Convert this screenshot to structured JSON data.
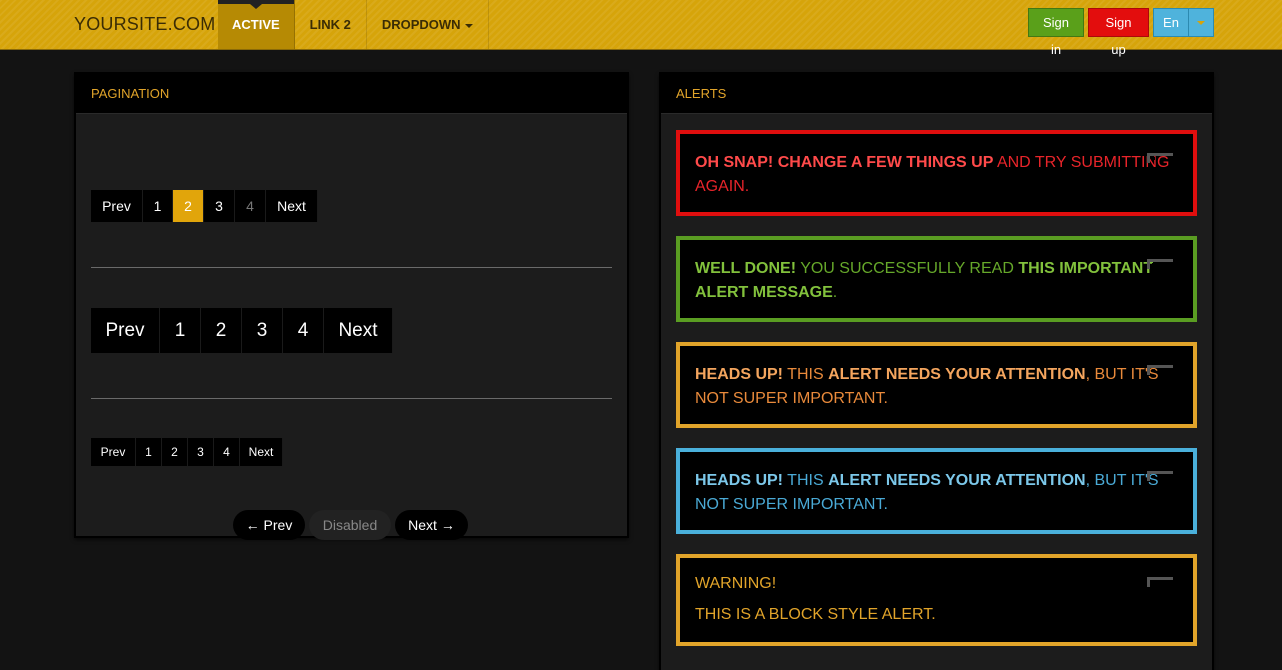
{
  "navbar": {
    "brand": "YOURSITE.COM",
    "items": [
      {
        "label": "ACTIVE"
      },
      {
        "label": "LINK 2"
      },
      {
        "label": "DROPDOWN"
      }
    ],
    "signin": "Sign in",
    "signup": "Sign up",
    "language": "En"
  },
  "pagination_panel": {
    "title": "PAGINATION",
    "pager_default": [
      "Prev",
      "1",
      "2",
      "3",
      "4",
      "Next"
    ],
    "pager_large": [
      "Prev",
      "1",
      "2",
      "3",
      "4",
      "Next"
    ],
    "pager_small": [
      "Prev",
      "1",
      "2",
      "3",
      "4",
      "Next"
    ],
    "pill_pager": {
      "prev": "← Prev",
      "disabled": "Disabled",
      "next": "Next →"
    }
  },
  "alerts_panel": {
    "title": "ALERTS",
    "danger": {
      "strong": "OH SNAP!",
      "strong2": "CHANGE A FEW THINGS UP",
      "text": "AND TRY SUBMITTING AGAIN."
    },
    "success": {
      "strong": "WELL DONE!",
      "text": "YOU SUCCESSFULLY READ",
      "strong2": "THIS IMPORTANT ALERT MESSAGE",
      "end": "."
    },
    "warning_inline": {
      "strong": "HEADS UP!",
      "text": "THIS",
      "strong2": "ALERT NEEDS YOUR ATTENTION",
      "end": ", BUT IT'S NOT SUPER IMPORTANT."
    },
    "info": {
      "strong": "HEADS UP!",
      "text": "THIS",
      "strong2": "ALERT NEEDS YOUR ATTENTION",
      "end": ", BUT IT'S NOT SUPER IMPORTANT."
    },
    "block": {
      "title": "WARNING!",
      "text": "THIS IS A BLOCK STYLE ALERT."
    }
  },
  "colors": {
    "navbar": "#d6a40a",
    "accent": "#e1a50b",
    "danger": "#e00e0e",
    "success": "#5a9d22",
    "warning": "#e1a42a",
    "info": "#4ab0db"
  }
}
